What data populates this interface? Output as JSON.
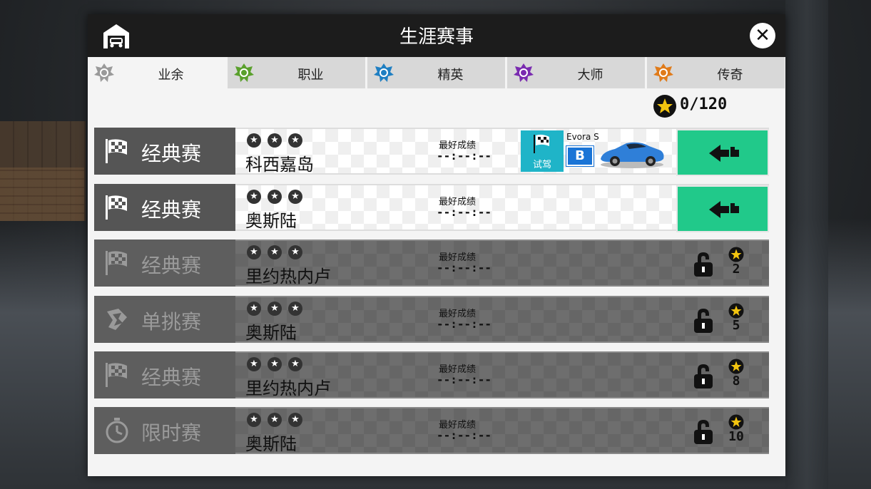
{
  "header": {
    "title": "生涯赛事",
    "close_symbol": "✕"
  },
  "tabs": [
    {
      "label": "业余",
      "badge_color": "#9a9a9a",
      "active": true
    },
    {
      "label": "职业",
      "badge_color": "#5aa02c",
      "active": false
    },
    {
      "label": "精英",
      "badge_color": "#1f7fc2",
      "active": false
    },
    {
      "label": "大师",
      "badge_color": "#7a2bb0",
      "active": false
    },
    {
      "label": "传奇",
      "badge_color": "#e07b1a",
      "active": false
    }
  ],
  "stars_total": "0/120",
  "best_label": "最好成绩",
  "best_time": "--:--:--",
  "promo": {
    "tile_label": "试驾",
    "car_name": "Evora S",
    "car_class": "B"
  },
  "events": [
    {
      "type": "经典赛",
      "track": "科西嘉岛",
      "locked": false,
      "icon": "checkered-flag-icon"
    },
    {
      "type": "经典赛",
      "track": "奥斯陆",
      "locked": false,
      "icon": "checkered-flag-icon"
    },
    {
      "type": "经典赛",
      "track": "里约热内卢",
      "locked": true,
      "required_stars": "2",
      "icon": "checkered-flag-icon"
    },
    {
      "type": "单挑赛",
      "track": "奥斯陆",
      "locked": true,
      "required_stars": "5",
      "icon": "versus-icon"
    },
    {
      "type": "经典赛",
      "track": "里约热内卢",
      "locked": true,
      "required_stars": "8",
      "icon": "checkered-flag-icon"
    },
    {
      "type": "限时赛",
      "track": "奥斯陆",
      "locked": true,
      "required_stars": "10",
      "icon": "stopwatch-icon"
    }
  ],
  "colors": {
    "accent_green": "#21c98a",
    "star_gold": "#f2c40f"
  }
}
